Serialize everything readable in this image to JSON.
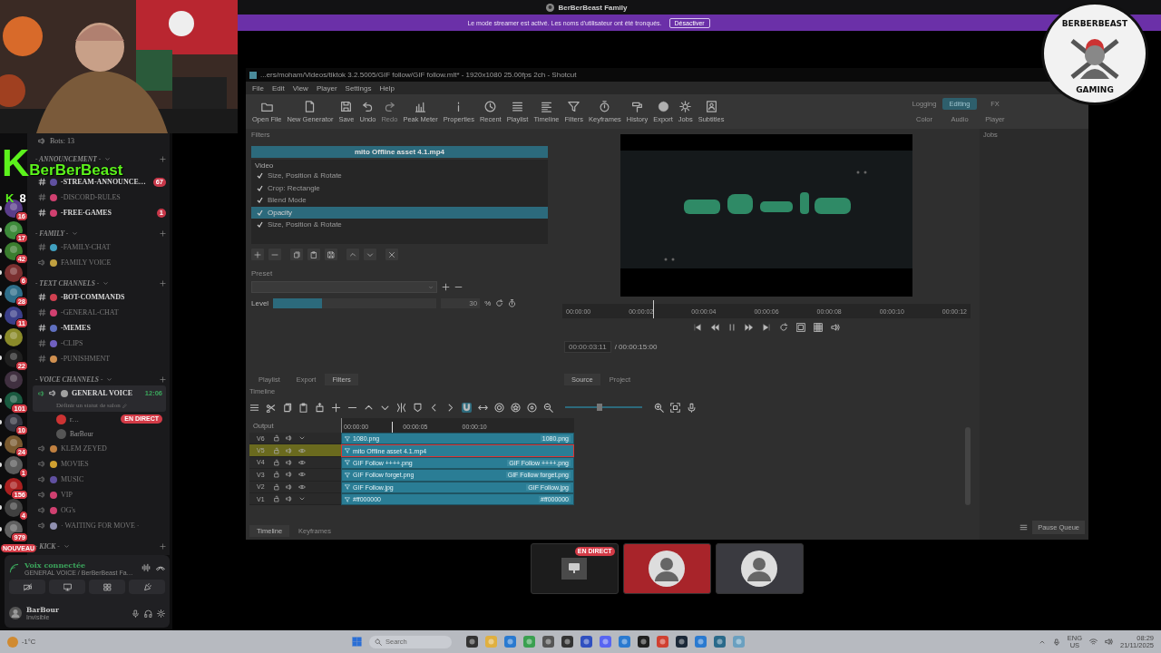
{
  "discord": {
    "title": "BerBerBeast Family",
    "banner": {
      "text": "Le mode streamer est activé. Les noms d'utilisateur ont été tronqués.",
      "button": "Désactiver"
    },
    "servers": [
      {
        "kind": "server",
        "unread": true,
        "badge": "16"
      },
      {
        "kind": "server",
        "unread": true,
        "badge": "17"
      },
      {
        "kind": "server",
        "unread": true,
        "badge": "42"
      },
      {
        "kind": "server",
        "unread": true,
        "badge": "6"
      },
      {
        "kind": "server",
        "unread": true,
        "badge": "28"
      },
      {
        "kind": "server",
        "unread": true,
        "badge": "11"
      },
      {
        "kind": "server",
        "unread": true
      },
      {
        "kind": "server",
        "unread": true,
        "badge": "22"
      },
      {
        "kind": "server",
        "unread": false
      },
      {
        "kind": "server",
        "unread": true,
        "badge": "101"
      },
      {
        "kind": "server",
        "unread": true,
        "badge": "10"
      },
      {
        "kind": "server",
        "unread": true,
        "badge": "24"
      },
      {
        "kind": "server",
        "unread": true,
        "badge": "1"
      },
      {
        "kind": "server",
        "unread": true,
        "badge": "156"
      },
      {
        "kind": "server",
        "unread": true,
        "badge": "4"
      },
      {
        "kind": "server",
        "unread": true,
        "badge": "979"
      },
      {
        "kind": "new",
        "badge": "NOUVEAU"
      }
    ],
    "channels": [
      {
        "kind": "info",
        "name": "Bots: 13"
      },
      {
        "kind": "category",
        "name": "- ANNOUNCEMENT -"
      },
      {
        "kind": "text",
        "name": "-STREAM-ANNOUNCE…",
        "unread": true,
        "badge": "67"
      },
      {
        "kind": "text",
        "name": "-DISCORD-RULES",
        "unread": false
      },
      {
        "kind": "text",
        "name": "-FREE-GAMES",
        "unread": true,
        "badge": "1"
      },
      {
        "kind": "category",
        "name": "- FAMILY -"
      },
      {
        "kind": "text",
        "name": "-FAMILY-CHAT",
        "unread": false
      },
      {
        "kind": "voice",
        "name": "FAMILY VOICE",
        "selected": false
      },
      {
        "kind": "category",
        "name": "- TEXT CHANNELS -"
      },
      {
        "kind": "text",
        "name": "-BOT-COMMANDS",
        "unread": true
      },
      {
        "kind": "text",
        "name": "-GENERAL-CHAT",
        "unread": false
      },
      {
        "kind": "text",
        "name": "-MEMES",
        "unread": true
      },
      {
        "kind": "text",
        "name": "-CLIPS",
        "unread": false
      },
      {
        "kind": "text",
        "name": "-PUNISHMENT",
        "unread": false
      },
      {
        "kind": "category",
        "name": "- VOICE CHANNELS -"
      },
      {
        "kind": "voice",
        "name": "GENERAL VOICE",
        "selected": true,
        "time": "12:06",
        "status": "Définir un statut de salon",
        "members": [
          {
            "name": "r…",
            "live": "EN DIRECT"
          },
          {
            "name": "BarBour"
          }
        ]
      },
      {
        "kind": "voice",
        "name": "KLEM ZEYED",
        "selected": false
      },
      {
        "kind": "voice",
        "name": "MOVIES",
        "selected": false
      },
      {
        "kind": "voice",
        "name": "MUSIC",
        "selected": false
      },
      {
        "kind": "voice",
        "name": "VIP",
        "selected": false
      },
      {
        "kind": "voice",
        "name": "OG's",
        "selected": false
      },
      {
        "kind": "voice",
        "name": "· WAITING FOR MOVE ·",
        "selected": false
      },
      {
        "kind": "category",
        "name": "- KICK -"
      }
    ],
    "voice_panel": {
      "status": "Voix connectée",
      "channel": "GENERAL VOICE / BerBerBeast Fa…"
    },
    "user": {
      "name": "BarBour",
      "status": "Invisible"
    }
  },
  "overlay": {
    "logo": "K",
    "name": "BerBerBeast",
    "small_logo": "K",
    "count": "8",
    "badge_top": "BERBERBEAST",
    "badge_bottom": "GAMING"
  },
  "shotcut": {
    "title": "...ers/moham/Videos/tiktok 3.2.5005/GIF follow/GIF follow.mlt* - 1920x1080 25.00fps 2ch - Shotcut",
    "menu": [
      "File",
      "Edit",
      "View",
      "Player",
      "Settings",
      "Help"
    ],
    "toolbar": [
      {
        "label": "Open File",
        "disabled": false
      },
      {
        "label": "New Generator",
        "disabled": false
      },
      {
        "label": "Save",
        "disabled": false
      },
      {
        "label": "Undo",
        "disabled": false
      },
      {
        "label": "Redo",
        "disabled": true
      },
      {
        "label": "Peak Meter",
        "disabled": false
      },
      {
        "label": "Properties",
        "disabled": false
      },
      {
        "label": "Recent",
        "disabled": false
      },
      {
        "label": "Playlist",
        "disabled": false
      },
      {
        "label": "Timeline",
        "disabled": false
      },
      {
        "label": "Filters",
        "disabled": false
      },
      {
        "label": "Keyframes",
        "disabled": false
      },
      {
        "label": "History",
        "disabled": false
      },
      {
        "label": "Export",
        "disabled": false
      },
      {
        "label": "Jobs",
        "disabled": false
      },
      {
        "label": "Subtitles",
        "disabled": false
      }
    ],
    "layouts": [
      {
        "label": "Logging",
        "selected": false
      },
      {
        "label": "Editing",
        "selected": true
      },
      {
        "label": "FX",
        "selected": false
      },
      {
        "label": "Color",
        "selected": false
      },
      {
        "label": "Audio",
        "selected": false
      },
      {
        "label": "Player",
        "selected": false
      }
    ],
    "filters": {
      "title": "Filters",
      "clip": "mito Offline asset 4.1.mp4",
      "group": "Video",
      "items": [
        {
          "label": "Size, Position & Rotate",
          "checked": true,
          "selected": false
        },
        {
          "label": "Crop: Rectangle",
          "checked": true,
          "selected": false
        },
        {
          "label": "Blend Mode",
          "checked": true,
          "selected": false
        },
        {
          "label": "Opacity",
          "checked": true,
          "selected": true
        },
        {
          "label": "Size, Position & Rotate",
          "checked": true,
          "selected": false
        }
      ],
      "preset_label": "Preset",
      "slider": {
        "label": "Level",
        "level": 0.3,
        "value": "30",
        "unit": "%"
      }
    },
    "left_tabs": [
      {
        "label": "Playlist",
        "selected": false
      },
      {
        "label": "Export",
        "selected": false
      },
      {
        "label": "Filters",
        "selected": true
      }
    ],
    "player": {
      "ruler": [
        "00:00:00",
        "00:00:02",
        "00:00:04",
        "00:00:06",
        "00:00:08",
        "00:00:10",
        "00:00:12"
      ],
      "position": "00:00:03:11",
      "duration": "/ 00:00:15:00",
      "tabs": [
        {
          "label": "Source",
          "selected": true
        },
        {
          "label": "Project",
          "selected": false
        }
      ]
    },
    "jobs": {
      "title": "Jobs",
      "button": "Pause Queue"
    },
    "timeline": {
      "title": "Timeline",
      "output": "Output",
      "ruler": [
        "00:00:00",
        "00:00:05",
        "00:00:10"
      ],
      "zoom": {
        "level": 0.45
      },
      "tracks": [
        {
          "name": "V6",
          "selected": false,
          "clip_start": "1080.png",
          "clip_end": "1080.png"
        },
        {
          "name": "V5",
          "selected": true,
          "clip_start": "mito Offline asset 4.1.mp4"
        },
        {
          "name": "V4",
          "selected": false,
          "clip_start": "GIF Follow ++++.png",
          "clip_end": "GIF Follow ++++.png"
        },
        {
          "name": "V3",
          "selected": false,
          "clip_start": "GIF Follow forget.png",
          "clip_end": "GIF Follow forget.png"
        },
        {
          "name": "V2",
          "selected": false,
          "clip_start": "GIF Follow.jpg",
          "clip_end": "GIF Follow.jpg"
        },
        {
          "name": "V1",
          "selected": false,
          "clip_start": "#ff000000",
          "clip_end": "#ff000000"
        }
      ],
      "tabs": [
        {
          "label": "Timeline",
          "selected": true
        },
        {
          "label": "Keyframes",
          "selected": false
        }
      ]
    }
  },
  "stream_tiles": [
    {
      "kind": "screen",
      "live": "EN DIRECT"
    },
    {
      "kind": "avatar",
      "color": "#a8242a"
    },
    {
      "kind": "avatar",
      "color": "#3a3a40"
    }
  ],
  "taskbar": {
    "weather": "-1°C",
    "search": "Search",
    "language": "ENG",
    "region": "US",
    "time": "08:29",
    "date": "21/11/2025"
  }
}
